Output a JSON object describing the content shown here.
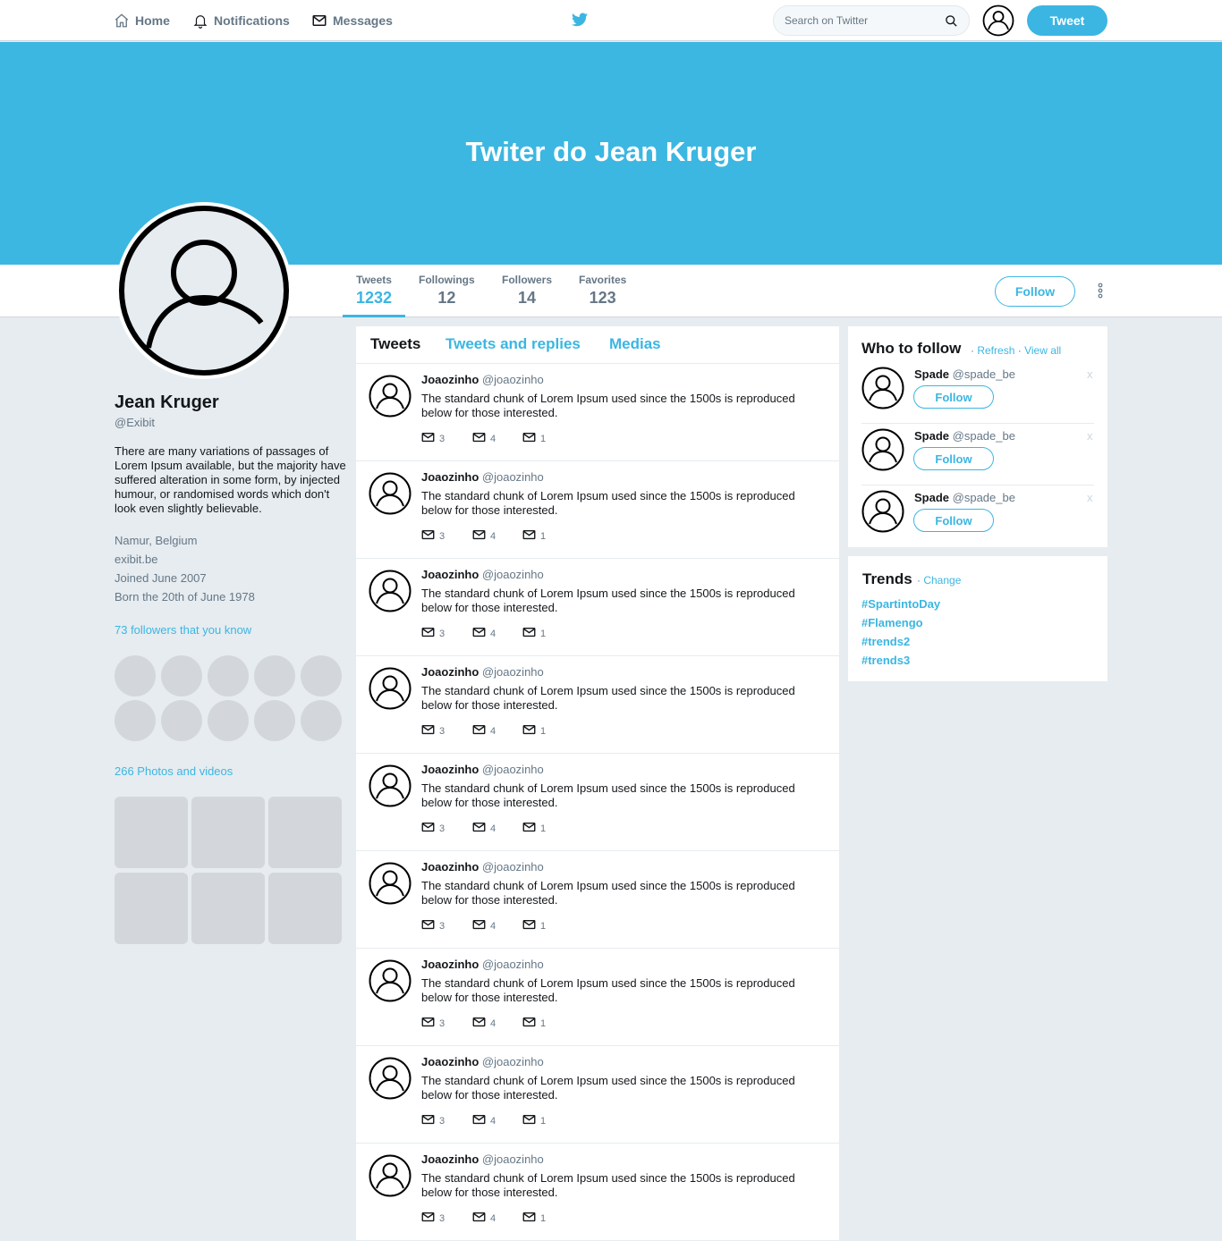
{
  "nav": {
    "home": "Home",
    "notifications": "Notifications",
    "messages": "Messages",
    "search_placeholder": "Search on Twitter",
    "tweet_button": "Tweet"
  },
  "banner": {
    "title": "Twiter do Jean Kruger"
  },
  "stats": [
    {
      "label": "Tweets",
      "value": "1232"
    },
    {
      "label": "Followings",
      "value": "12"
    },
    {
      "label": "Followers",
      "value": "14"
    },
    {
      "label": "Favorites",
      "value": "123"
    }
  ],
  "profile": {
    "follow_label": "Follow",
    "name": "Jean Kruger",
    "handle": "@Exibit",
    "bio": "There are many variations of passages of Lorem Ipsum available, but the majority have suffered alteration in some form, by injected humour, or randomised words which don't look even slightly believable.",
    "location": "Namur, Belgium",
    "website": "exibit.be",
    "joined": "Joined June 2007",
    "born": "Born the 20th of June 1978",
    "followers_you_know": "73 followers that you know",
    "photos_videos": "266 Photos and videos"
  },
  "tabs": [
    "Tweets",
    "Tweets and replies",
    "Medias"
  ],
  "tweet": {
    "name": "Joaozinho",
    "handle": "@joaozinho",
    "text": "The standard chunk of Lorem Ipsum used since the 1500s is reproduced below for those interested.",
    "counts": [
      "3",
      "4",
      "1"
    ]
  },
  "who_to_follow": {
    "title": "Who to follow",
    "sep": "·",
    "refresh": "Refresh",
    "view_all": "View all",
    "items": [
      {
        "name": "Spade",
        "handle": "@spade_be",
        "follow": "Follow",
        "close": "x"
      },
      {
        "name": "Spade",
        "handle": "@spade_be",
        "follow": "Follow",
        "close": "x"
      },
      {
        "name": "Spade",
        "handle": "@spade_be",
        "follow": "Follow",
        "close": "x"
      }
    ]
  },
  "trends": {
    "title": "Trends",
    "sep": "·",
    "change": "Change",
    "items": [
      "#SpartintoDay",
      "#Flamengo",
      "#trends2",
      "#trends3"
    ]
  },
  "colors": {
    "accent": "#3bb6e2",
    "banner": "#3cb7e1",
    "background": "#e6ecf0",
    "placeholder": "#d3d7db"
  }
}
